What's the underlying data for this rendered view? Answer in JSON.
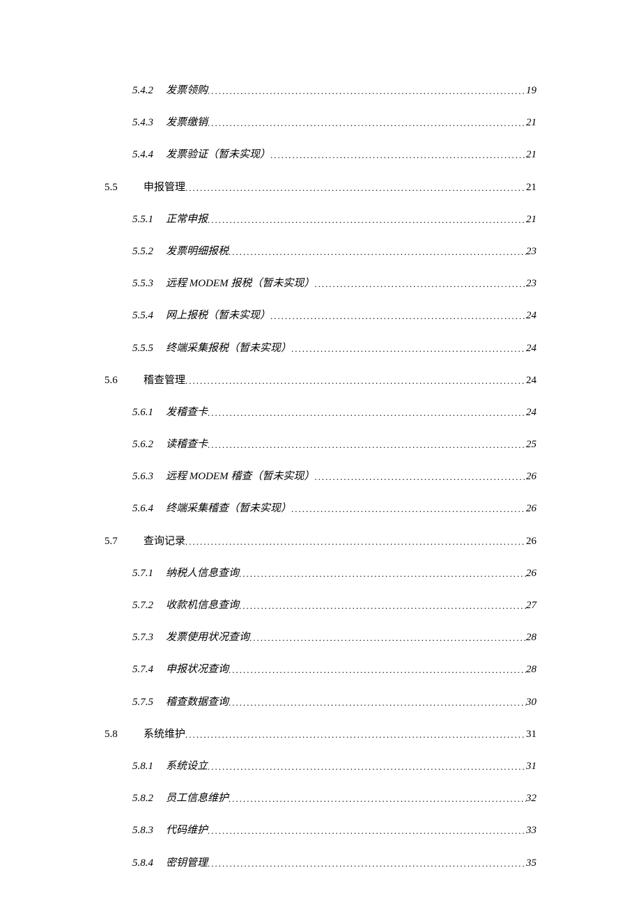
{
  "toc": [
    {
      "level": 2,
      "num": "5.4.2",
      "title": "发票领购",
      "page": "19"
    },
    {
      "level": 2,
      "num": "5.4.3",
      "title": "发票缴销",
      "page": "21"
    },
    {
      "level": 2,
      "num": "5.4.4",
      "title": "发票验证（暂未实现）",
      "page": "21"
    },
    {
      "level": 1,
      "num": "5.5",
      "title": "申报管理",
      "page": "21"
    },
    {
      "level": 2,
      "num": "5.5.1",
      "title": "正常申报",
      "page": "21"
    },
    {
      "level": 2,
      "num": "5.5.2",
      "title": "发票明细报税",
      "page": "23"
    },
    {
      "level": 2,
      "num": "5.5.3",
      "title": "远程 MODEM 报税（暂未实现）",
      "page": "23"
    },
    {
      "level": 2,
      "num": "5.5.4",
      "title": "网上报税（暂未实现）",
      "page": "24"
    },
    {
      "level": 2,
      "num": "5.5.5",
      "title": "终端采集报税（暂未实现）",
      "page": "24"
    },
    {
      "level": 1,
      "num": "5.6",
      "title": "稽查管理",
      "page": "24"
    },
    {
      "level": 2,
      "num": "5.6.1",
      "title": "发稽查卡",
      "page": "24"
    },
    {
      "level": 2,
      "num": "5.6.2",
      "title": "读稽查卡",
      "page": "25"
    },
    {
      "level": 2,
      "num": "5.6.3",
      "title": "远程 MODEM 稽查（暂未实现）",
      "page": "26"
    },
    {
      "level": 2,
      "num": "5.6.4",
      "title": "终端采集稽查（暂未实现）",
      "page": "26"
    },
    {
      "level": 1,
      "num": "5.7",
      "title": "查询记录",
      "page": "26"
    },
    {
      "level": 2,
      "num": "5.7.1",
      "title": "纳税人信息查询",
      "page": "26"
    },
    {
      "level": 2,
      "num": "5.7.2",
      "title": "收款机信息查询",
      "page": "27"
    },
    {
      "level": 2,
      "num": "5.7.3",
      "title": "发票使用状况查询",
      "page": "28"
    },
    {
      "level": 2,
      "num": "5.7.4",
      "title": "申报状况查询",
      "page": "28"
    },
    {
      "level": 2,
      "num": "5.7.5",
      "title": "稽查数据查询",
      "page": "30"
    },
    {
      "level": 1,
      "num": "5.8",
      "title": "系统维护",
      "page": "31"
    },
    {
      "level": 2,
      "num": "5.8.1",
      "title": "系统设立",
      "page": "31"
    },
    {
      "level": 2,
      "num": "5.8.2",
      "title": "员工信息维护",
      "page": "32"
    },
    {
      "level": 2,
      "num": "5.8.3",
      "title": "代码维护",
      "page": "33"
    },
    {
      "level": 2,
      "num": "5.8.4",
      "title": "密钥管理",
      "page": "35"
    }
  ]
}
